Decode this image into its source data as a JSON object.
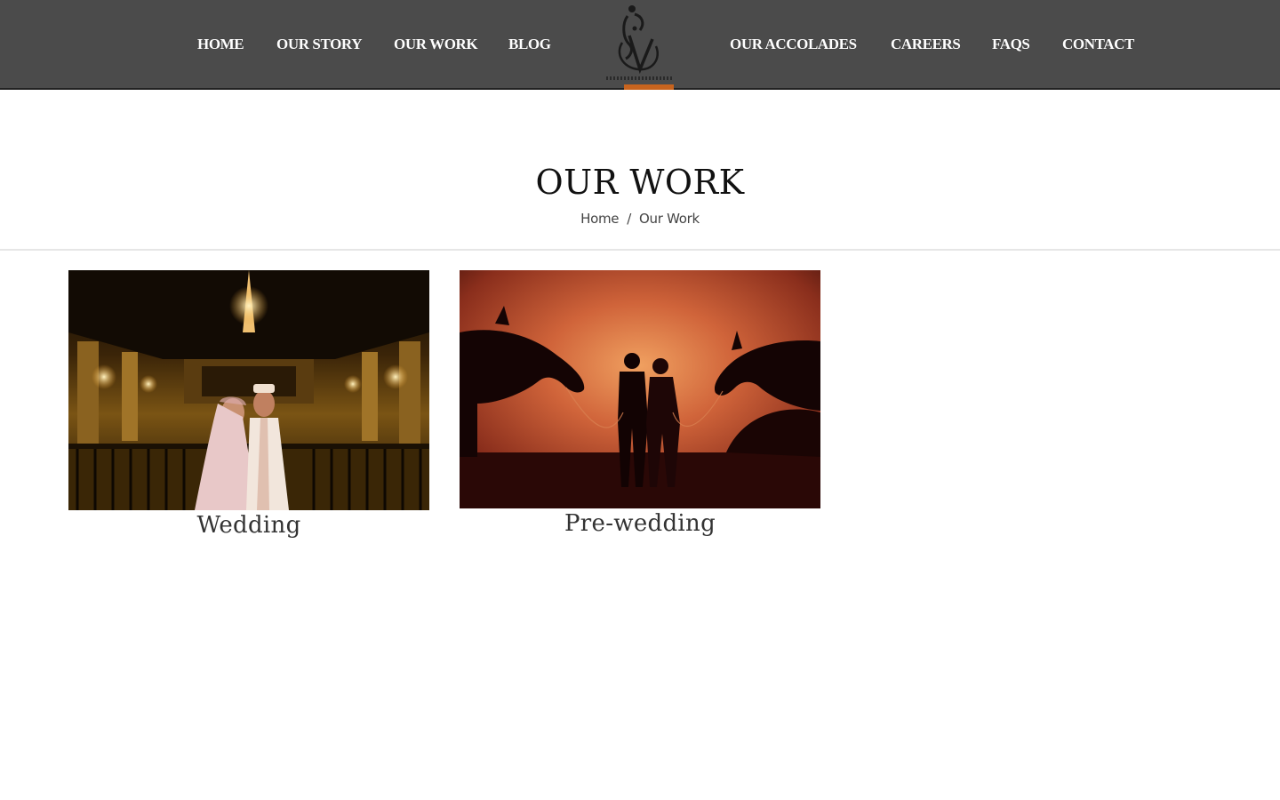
{
  "nav": {
    "left": [
      {
        "label": "HOME"
      },
      {
        "label": "OUR STORY"
      },
      {
        "label": "OUR WORK"
      },
      {
        "label": "BLOG"
      }
    ],
    "right": [
      {
        "label": "OUR ACCOLADES"
      },
      {
        "label": "CAREERS"
      },
      {
        "label": "FAQS"
      },
      {
        "label": "CONTACT"
      }
    ],
    "logo_icon": "monogram-logo-icon"
  },
  "page": {
    "title": "OUR WORK",
    "breadcrumb": {
      "home": "Home",
      "separator": "/",
      "current": "Our Work"
    }
  },
  "gallery": [
    {
      "caption": "Wedding",
      "image": "wedding-couple-photo"
    },
    {
      "caption": "Pre-wedding",
      "image": "pre-wedding-silhouette-photo"
    }
  ],
  "colors": {
    "topbar": "#4b4b4b",
    "logo_accent": "#c8641e",
    "page_background": "#ffffff"
  }
}
